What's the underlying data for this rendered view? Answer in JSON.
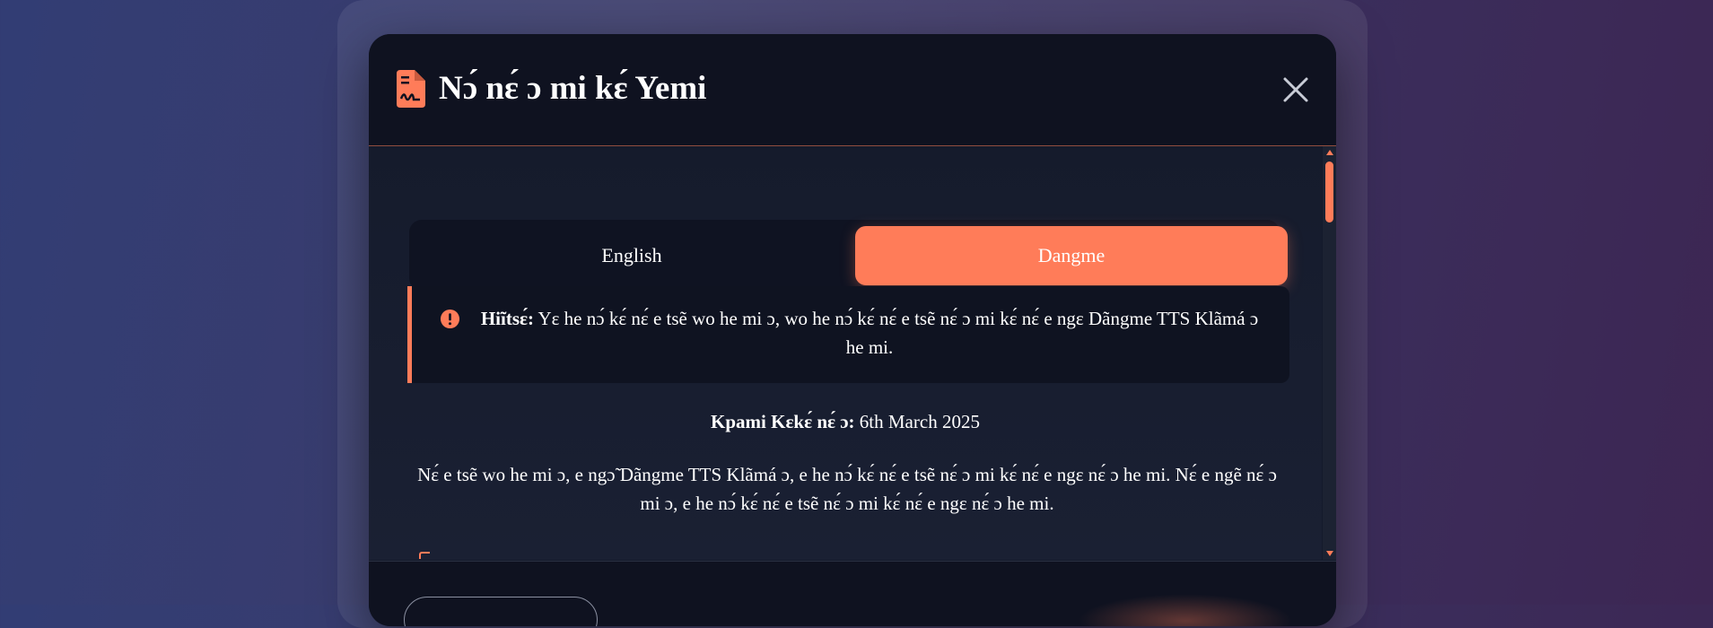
{
  "modal": {
    "title": "Nɔ́ nɛ́ ɔ mi kɛ́ Yemi"
  },
  "tabs": [
    {
      "label": "English",
      "active": false
    },
    {
      "label": "Dangme",
      "active": true
    }
  ],
  "notice": {
    "label": "Hiĩtsɛ́:",
    "text": " Yɛ he nɔ́ kɛ́ nɛ́ e tsẽ wo he mi ɔ, wo he nɔ́ kɛ́ nɛ́ e tsẽ nɛ́ ɔ mi kɛ́ nɛ́ e ngɛ Dãngme TTS Klãmá ɔ he mi."
  },
  "content": {
    "date_label": "Kpami Kɛkɛ́ nɛ́ ɔ:",
    "date_value": " 6th March 2025",
    "paragraph": "Nɛ́ e tsẽ wo he mi ɔ, e ngɔ̃ Dãngme TTS Klãmá ɔ, e he nɔ́ kɛ́ nɛ́ e tsẽ nɛ́ ɔ mi kɛ́ nɛ́ e ngɛ nɛ́ ɔ he mi. Nɛ́ e ngẽ nɛ́ ɔ mi ɔ, e he nɔ́ kɛ́ nɛ́ e tsẽ nɛ́ ɔ mi kɛ́ nɛ́ e ngɛ nɛ́ ɔ he mi."
  },
  "colors": {
    "accent": "#ff7c59",
    "modal_bg": "#141a2b",
    "header_bg": "#0f1220"
  },
  "icons": {
    "title": "document-signature-icon",
    "close": "close-icon",
    "notice": "exclamation-circle-icon"
  }
}
